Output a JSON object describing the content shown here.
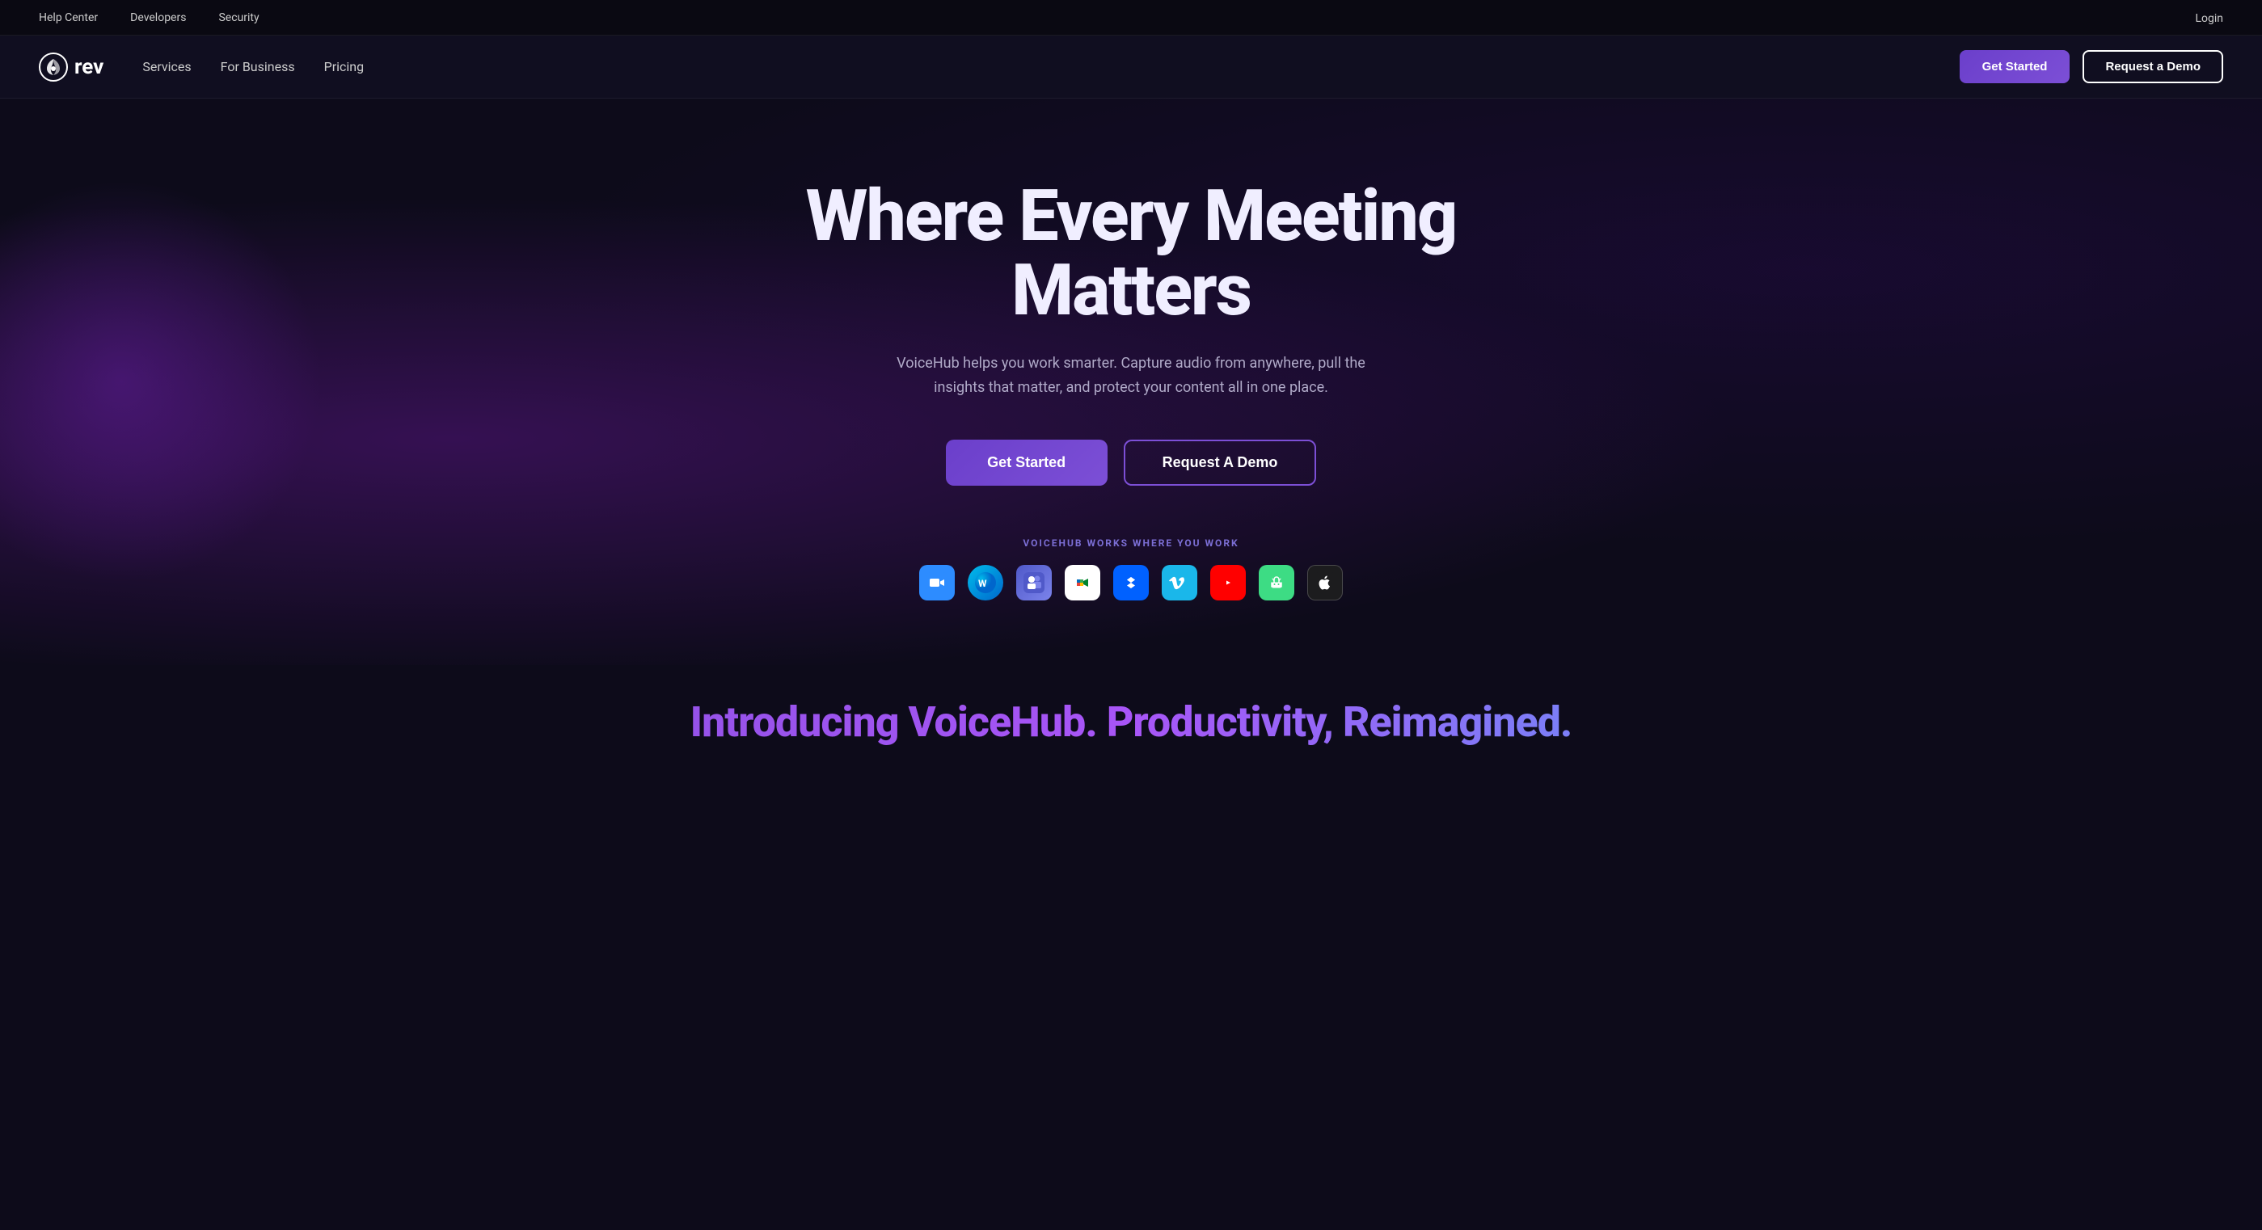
{
  "topbar": {
    "links": [
      {
        "label": "Help Center",
        "name": "help-center-link"
      },
      {
        "label": "Developers",
        "name": "developers-link"
      },
      {
        "label": "Security",
        "name": "security-link"
      }
    ],
    "login_label": "Login"
  },
  "nav": {
    "logo_text": "rev",
    "links": [
      {
        "label": "Services",
        "name": "services-nav-link"
      },
      {
        "label": "For Business",
        "name": "for-business-nav-link"
      },
      {
        "label": "Pricing",
        "name": "pricing-nav-link"
      }
    ],
    "get_started_label": "Get Started",
    "request_demo_label": "Request a Demo"
  },
  "hero": {
    "title": "Where Every Meeting Matters",
    "subtitle": "VoiceHub helps you work smarter. Capture audio from anywhere, pull the insights that matter, and protect your content all in one place.",
    "get_started_label": "Get Started",
    "request_demo_label": "Request A Demo",
    "integrations_label": "VOICEHUB WORKS WHERE YOU WORK",
    "integrations": [
      {
        "name": "zoom",
        "label": "Zoom",
        "icon_name": "zoom-icon"
      },
      {
        "name": "webex",
        "label": "Webex",
        "icon_name": "webex-icon"
      },
      {
        "name": "teams",
        "label": "Microsoft Teams",
        "icon_name": "teams-icon"
      },
      {
        "name": "meet",
        "label": "Google Meet",
        "icon_name": "meet-icon"
      },
      {
        "name": "dropbox",
        "label": "Dropbox",
        "icon_name": "dropbox-icon"
      },
      {
        "name": "vimeo",
        "label": "Vimeo",
        "icon_name": "vimeo-icon"
      },
      {
        "name": "youtube",
        "label": "YouTube",
        "icon_name": "youtube-icon"
      },
      {
        "name": "android",
        "label": "Android",
        "icon_name": "android-icon"
      },
      {
        "name": "apple",
        "label": "Apple",
        "icon_name": "apple-icon"
      }
    ]
  },
  "bottom": {
    "tagline": "Introducing VoiceHub. Productivity, Reimagined."
  }
}
